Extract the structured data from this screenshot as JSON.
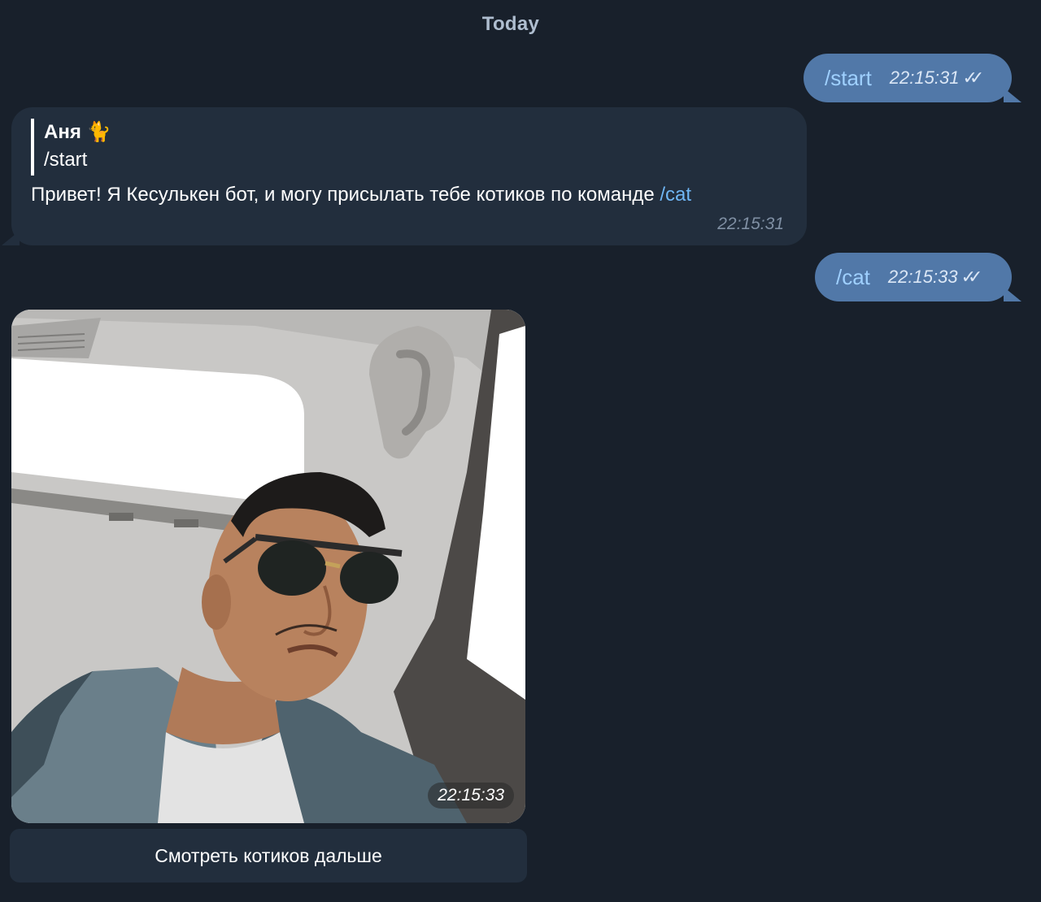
{
  "date_separator": "Today",
  "messages": {
    "out1": {
      "text": "/start",
      "time": "22:15:31",
      "checks": "✓✓"
    },
    "in1": {
      "reply_name": "Аня 🐈",
      "reply_text": "/start",
      "text_before": "Привет! Я Кесулькен бот, и могу присылать тебе котиков по команде ",
      "text_link": "/cat",
      "time": "22:15:31"
    },
    "out2": {
      "text": "/cat",
      "time": "22:15:33",
      "checks": "✓✓"
    },
    "photo": {
      "time": "22:15:33"
    }
  },
  "keyboard": {
    "button_label": "Смотреть котиков дальше"
  },
  "colors": {
    "background": "#18202b",
    "outgoing_bubble": "#5178a8",
    "incoming_bubble": "#222e3d",
    "link": "#6fb6f5"
  }
}
